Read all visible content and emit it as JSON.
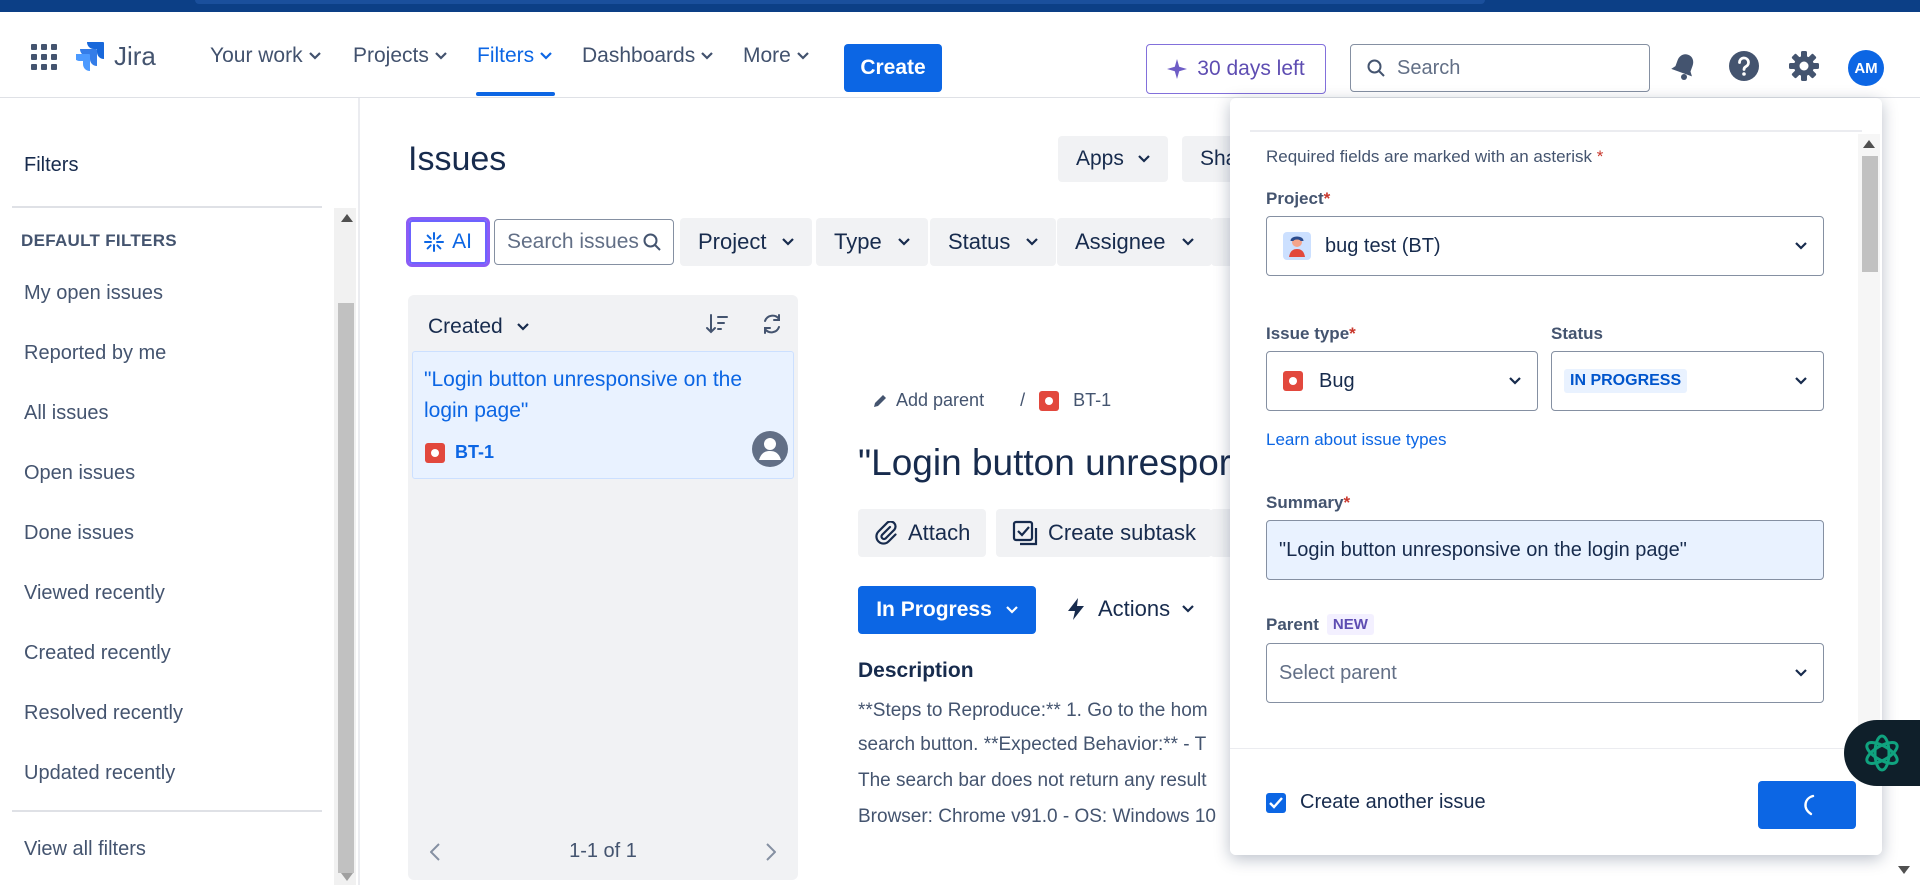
{
  "nav": {
    "logo_text": "Jira",
    "items": [
      {
        "label": "Your work"
      },
      {
        "label": "Projects"
      },
      {
        "label": "Filters"
      },
      {
        "label": "Dashboards"
      },
      {
        "label": "More"
      }
    ],
    "create_label": "Create",
    "trial_label": "30 days left",
    "search_placeholder": "Search",
    "avatar_initials": "AM",
    "active_item": "Filters",
    "colors": {
      "accent": "#0c66e4",
      "brand_dark": "#0c3f86",
      "ai_purple": "#8b5cf6"
    },
    "icons": [
      "app-switcher-icon",
      "jira-logo-icon",
      "sparkle-icon",
      "search-icon",
      "bell-icon",
      "help-icon",
      "settings-icon"
    ]
  },
  "sidebar": {
    "title": "Filters",
    "section_label": "DEFAULT FILTERS",
    "items": [
      {
        "label": "My open issues"
      },
      {
        "label": "Reported by me"
      },
      {
        "label": "All issues"
      },
      {
        "label": "Open issues"
      },
      {
        "label": "Done issues"
      },
      {
        "label": "Viewed recently"
      },
      {
        "label": "Created recently"
      },
      {
        "label": "Resolved recently"
      },
      {
        "label": "Updated recently"
      }
    ],
    "view_all_label": "View all filters"
  },
  "main": {
    "title": "Issues",
    "apps_label": "Apps",
    "share_label": "Sha",
    "ai_label": "AI",
    "search_placeholder": "Search issues",
    "filters": [
      {
        "label": "Project"
      },
      {
        "label": "Type"
      },
      {
        "label": "Status"
      },
      {
        "label": "Assignee"
      }
    ],
    "sort_label": "Created",
    "issue_card": {
      "title": "\"Login button unresponsive on the login page\"",
      "key": "BT-1"
    },
    "pager_text": "1-1 of 1"
  },
  "detail": {
    "add_parent_label": "Add parent",
    "breadcrumb_sep": "/",
    "issue_key": "BT-1",
    "title": "\"Login button unrespor",
    "attach_label": "Attach",
    "subtask_label": "Create subtask",
    "status_label": "In Progress",
    "actions_label": "Actions",
    "description_label": "Description",
    "description_lines": [
      "**Steps to Reproduce:** 1. Go to the hom",
      "search button. **Expected Behavior:** - T",
      "The search bar does not return any result",
      "Browser: Chrome v91.0 - OS: Windows 10"
    ]
  },
  "modal": {
    "required_note": "Required fields are marked with an asterisk",
    "asterisk": "*",
    "project_label": "Project",
    "project_value": "bug test (BT)",
    "issue_type_label": "Issue type",
    "issue_type_value": "Bug",
    "status_label": "Status",
    "status_value": "IN PROGRESS",
    "learn_link": "Learn about issue types",
    "summary_label": "Summary",
    "summary_value": "\"Login button unresponsive on the login page\"",
    "parent_label": "Parent",
    "parent_badge": "NEW",
    "parent_placeholder": "Select parent",
    "create_another_label": "Create another issue",
    "create_another_checked": true
  }
}
